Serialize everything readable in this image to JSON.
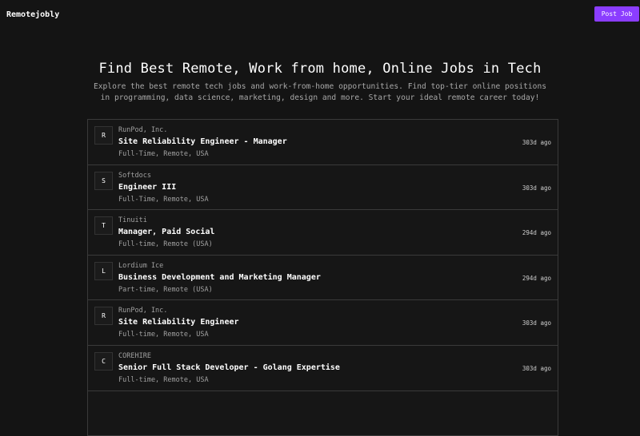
{
  "header": {
    "brand": "Remotejobly",
    "post_job_label": "Post Job"
  },
  "hero": {
    "title": "Find Best Remote, Work from home, Online Jobs in Tech",
    "subtitle": "Explore the best remote tech jobs and work-from-home opportunities. Find top-tier online positions in programming, data science, marketing, design and more. Start your ideal remote career today!"
  },
  "jobs": [
    {
      "initial": "R",
      "company": "RunPod, Inc.",
      "title": "Site Reliability Engineer - Manager",
      "meta": "Full-Time, Remote, USA",
      "age": "303d ago"
    },
    {
      "initial": "S",
      "company": "Softdocs",
      "title": "Engineer III",
      "meta": "Full-Time, Remote, USA",
      "age": "303d ago"
    },
    {
      "initial": "T",
      "company": "Tinuiti",
      "title": "Manager, Paid Social",
      "meta": "Full-time, Remote (USA)",
      "age": "294d ago"
    },
    {
      "initial": "L",
      "company": "Lordium Ice",
      "title": "Business Development and Marketing Manager",
      "meta": "Part-time, Remote (USA)",
      "age": "294d ago"
    },
    {
      "initial": "R",
      "company": "RunPod, Inc.",
      "title": "Site Reliability Engineer",
      "meta": "Full-time, Remote, USA",
      "age": "303d ago"
    },
    {
      "initial": "C",
      "company": "COREHIRE",
      "title": "Senior Full Stack Developer - Golang Expertise",
      "meta": "Full-time, Remote, USA",
      "age": "303d ago"
    }
  ]
}
